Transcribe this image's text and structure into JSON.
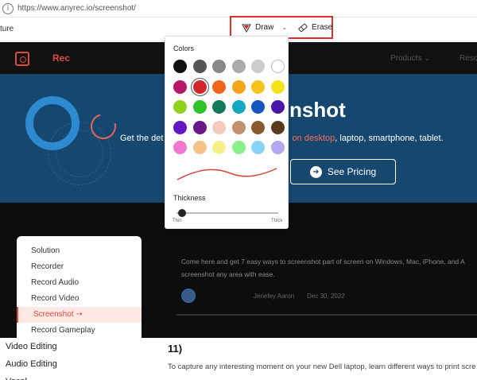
{
  "browser": {
    "url": "https://www.anyrec.io/screenshot/"
  },
  "toolbar": {
    "capture_label": "ture",
    "draw_label": "Draw",
    "erase_label": "Erase",
    "highlight_color": "#e0302a"
  },
  "site": {
    "brand": "Rec",
    "nav_products": "Products",
    "nav_resources": "Reso",
    "hero": {
      "title": "nshot",
      "subtitle_start": "Get the det",
      "subtitle_highlight": "on desktop",
      "subtitle_end": ", laptop, smartphone, tablet.",
      "pricing_label": "See Pricing"
    },
    "article": {
      "excerpt": "Come here and get 7 easy ways to screenshot part of screen on Windows, Mac, iPhone, and A screenshot any area with ease.",
      "author": "Jenefey Aaron",
      "date": "Dec 30, 2022"
    },
    "menu": {
      "items": [
        "Solution",
        "Recorder",
        "Record Audio",
        "Record Video",
        "Screenshot",
        "Record Gameplay"
      ],
      "active_index": 4
    },
    "lower": {
      "side_items": [
        "Video Editing",
        "Audio Editing",
        "Vocal..."
      ],
      "heading": "11)",
      "paragraph": "To capture any interesting moment on your new Dell laptop, learn different ways to print scre"
    },
    "accent_color": "#e04a3a",
    "hero_bg": "#16486f"
  },
  "popup": {
    "colors_label": "Colors",
    "thickness_label": "Thickness",
    "thin_label": "Thin",
    "thick_label": "Thick",
    "thickness_value": 0.0,
    "selected_color_index": 7,
    "swatch_colors": [
      "#111111",
      "#555555",
      "#888888",
      "#aaaaaa",
      "#cccccc",
      "#ffffff",
      "#b5176a",
      "#d2262a",
      "#f0651a",
      "#f5a51b",
      "#f6c21c",
      "#f5e21c",
      "#8fd21c",
      "#2bc22a",
      "#117a5a",
      "#13a7c2",
      "#1555c2",
      "#4b16a7",
      "#6416c2",
      "#6a178a",
      "#f5c9be",
      "#c2906a",
      "#8a5a2a",
      "#5a3a1a",
      "#f07ad2",
      "#f5c38a",
      "#f5f08a",
      "#8af08a",
      "#8ad2f5",
      "#b5a7f0"
    ],
    "stroke_color": "#d2463a"
  }
}
